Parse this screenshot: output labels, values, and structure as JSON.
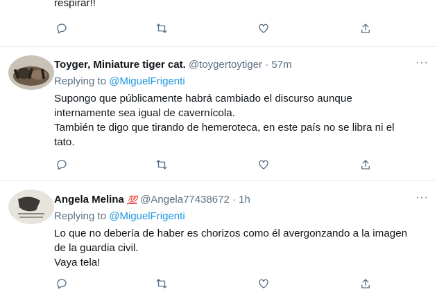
{
  "tweet0": {
    "text_tail": "respirar!!"
  },
  "tweet1": {
    "name": "Toyger, Miniature tiger cat.",
    "handle": "@toygertoytiger",
    "sep": "·",
    "time": "57m",
    "replying_label": "Replying to",
    "mention": "@MiguelFrigenti",
    "lines": [
      "Supongo que públicamente habrá cambiado el discurso aunque",
      "internamente sea igual de cavernícola.",
      "También te digo que tirando de hemeroteca, en este país no se libra ni el",
      "tato."
    ],
    "more": "···"
  },
  "tweet2": {
    "name": "Angela Melina",
    "badge": "💯",
    "handle": "@Angela77438672",
    "sep": "·",
    "time": "1h",
    "replying_label": "Replying to",
    "mention": "@MiguelFrigenti",
    "lines": [
      "Lo que no debería de haber es chorizos como él avergonzando a la imagen",
      "de la  guardia civil.",
      "Vaya tela!"
    ],
    "more": "···"
  },
  "icons": [
    "reply-icon",
    "retweet-icon",
    "like-icon",
    "share-icon"
  ],
  "colors": {
    "link": "#1b95e0",
    "muted": "#5b7083",
    "text": "#0f1419",
    "divider": "#e6ecf0"
  }
}
